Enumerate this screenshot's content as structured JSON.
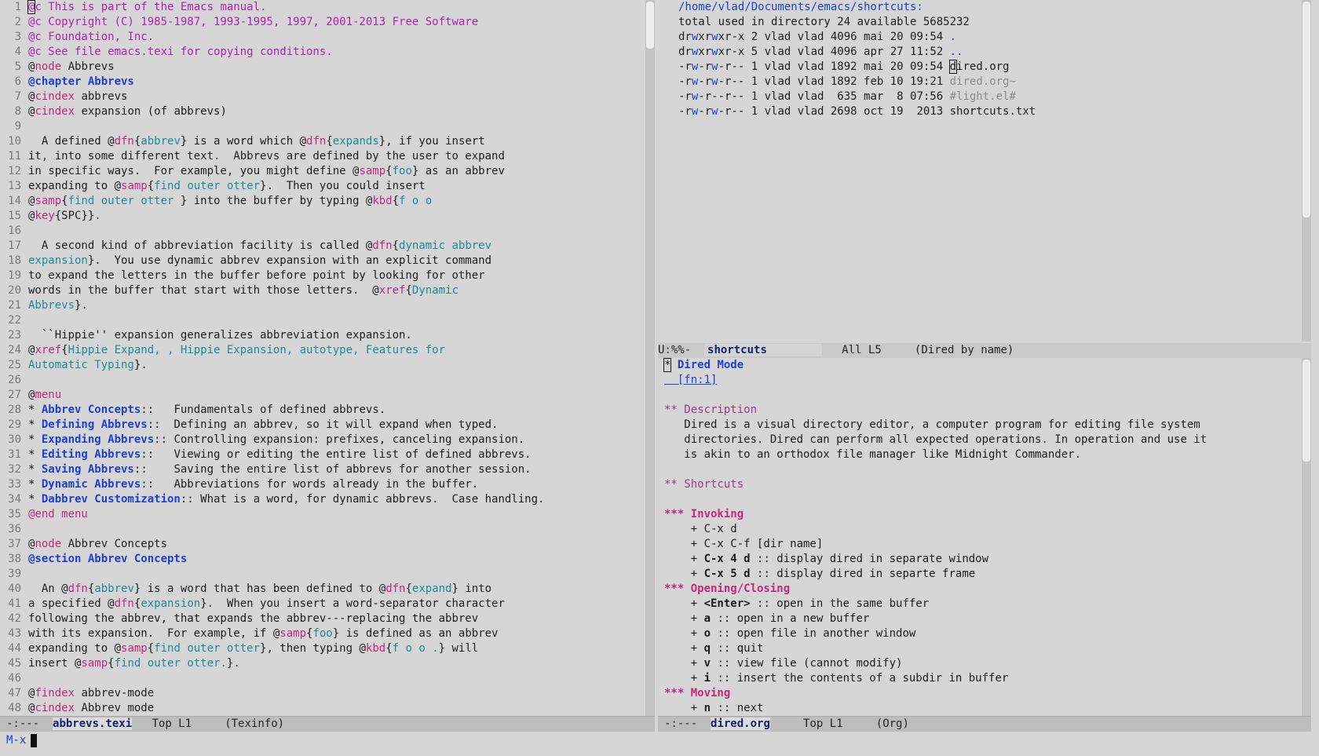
{
  "left": {
    "line_numbers": [
      "1",
      "2",
      "3",
      "4",
      "5",
      "6",
      "7",
      "8",
      "9",
      "10",
      "11",
      "12",
      "13",
      "14",
      "15",
      "16",
      "17",
      "18",
      "19",
      "20",
      "21",
      "22",
      "23",
      "24",
      "25",
      "26",
      "27",
      "28",
      "29",
      "30",
      "31",
      "32",
      "33",
      "34",
      "35",
      "36",
      "37",
      "38",
      "39",
      "40",
      "41",
      "42",
      "43",
      "44",
      "45",
      "46",
      "47",
      "48"
    ],
    "lines": [
      "@c This is part of the Emacs manual.",
      "@c Copyright (C) 1985-1987, 1993-1995, 1997, 2001-2013 Free Software",
      "@c Foundation, Inc.",
      "@c See file emacs.texi for copying conditions.",
      "@node Abbrevs",
      "@chapter Abbrevs",
      "@cindex abbrevs",
      "@cindex expansion (of abbrevs)",
      "",
      "  A defined @dfn{abbrev} is a word which @dfn{expands}, if you insert",
      "it, into some different text.  Abbrevs are defined by the user to expand",
      "in specific ways.  For example, you might define @samp{foo} as an abbrev",
      "expanding to @samp{find outer otter}.  Then you could insert",
      "@samp{find outer otter } into the buffer by typing @kbd{f o o",
      "@key{SPC}}.",
      "",
      "  A second kind of abbreviation facility is called @dfn{dynamic abbrev",
      "expansion}.  You use dynamic abbrev expansion with an explicit command",
      "to expand the letters in the buffer before point by looking for other",
      "words in the buffer that start with those letters.  @xref{Dynamic",
      "Abbrevs}.",
      "",
      "  ``Hippie'' expansion generalizes abbreviation expansion.",
      "@xref{Hippie Expand, , Hippie Expansion, autotype, Features for",
      "Automatic Typing}.",
      "",
      "@menu",
      "* Abbrev Concepts::   Fundamentals of defined abbrevs.",
      "* Defining Abbrevs::  Defining an abbrev, so it will expand when typed.",
      "* Expanding Abbrevs:: Controlling expansion: prefixes, canceling expansion.",
      "* Editing Abbrevs::   Viewing or editing the entire list of defined abbrevs.",
      "* Saving Abbrevs::    Saving the entire list of abbrevs for another session.",
      "* Dynamic Abbrevs::   Abbreviations for words already in the buffer.",
      "* Dabbrev Customization:: What is a word, for dynamic abbrevs.  Case handling.",
      "@end menu",
      "",
      "@node Abbrev Concepts",
      "@section Abbrev Concepts",
      "",
      "  An @dfn{abbrev} is a word that has been defined to @dfn{expand} into",
      "a specified @dfn{expansion}.  When you insert a word-separator character",
      "following the abbrev, that expands the abbrev---replacing the abbrev",
      "with its expansion.  For example, if @samp{foo} is defined as an abbrev",
      "expanding to @samp{find outer otter}, then typing @kbd{f o o .} will",
      "insert @samp{find outer otter.}.",
      "",
      "@findex abbrev-mode",
      "@cindex Abbrev mode"
    ],
    "modeline": {
      "status": "-:---",
      "buffer": "abbrevs.texi",
      "position": "Top L1",
      "mode": "(Texinfo)"
    }
  },
  "dired": {
    "path": "/home/vlad/Documents/emacs/shortcuts:",
    "summary": "total used in directory 24 available 5685232",
    "entries": [
      {
        "perms": "drwxrwxr-x",
        "info": " 2 vlad vlad 4096 mai 20 09:54 ",
        "name": "."
      },
      {
        "perms": "drwxrwxr-x",
        "info": " 5 vlad vlad 4096 apr 27 11:52 ",
        "name": ".."
      },
      {
        "perms": "-rw-rw-r--",
        "info": " 1 vlad vlad 1892 mai 20 09:54 ",
        "name": "dired.org"
      },
      {
        "perms": "-rw-rw-r--",
        "info": " 1 vlad vlad 1892 feb 10 19:21 ",
        "name": "dired.org~"
      },
      {
        "perms": "-rw-r--r--",
        "info": " 1 vlad vlad  635 mar  8 07:56 ",
        "name": "#light.el#"
      },
      {
        "perms": "-rw-rw-r--",
        "info": " 1 vlad vlad 2698 oct 19  2013 ",
        "name": "shortcuts.txt"
      }
    ],
    "modeline": {
      "status": "U:%%-",
      "buffer": "shortcuts",
      "position": "All L5",
      "mode": "(Dired by name)"
    }
  },
  "org": {
    "lines": [
      {
        "cls": "h1",
        "text": "* Dired Mode"
      },
      {
        "cls": "fn",
        "text": "  [fn:1]"
      },
      {
        "cls": "",
        "text": ""
      },
      {
        "cls": "h2",
        "text": "** Description"
      },
      {
        "cls": "",
        "text": "   Dired is a visual directory editor, a computer program for editing file system"
      },
      {
        "cls": "",
        "text": "   directories. Dired can perform all expected operations. In operation and use it"
      },
      {
        "cls": "",
        "text": "   is akin to an orthodox file manager like Midnight Commander."
      },
      {
        "cls": "",
        "text": ""
      },
      {
        "cls": "h2",
        "text": "** Shortcuts"
      },
      {
        "cls": "",
        "text": ""
      },
      {
        "cls": "h3",
        "text": "*** Invoking"
      },
      {
        "cls": "",
        "text": "    + C-x d"
      },
      {
        "cls": "",
        "text": "    + C-x C-f [dir name]"
      },
      {
        "cls": "",
        "key": "C-x 4 d",
        "text": " :: display dired in separate window"
      },
      {
        "cls": "",
        "key": "C-x 5 d",
        "text": " :: display dired in separte frame"
      },
      {
        "cls": "h3",
        "text": "*** Opening/Closing"
      },
      {
        "cls": "",
        "key": "<Enter>",
        "text": " :: open in the same buffer"
      },
      {
        "cls": "",
        "key": "a",
        "text": " :: open in a new buffer"
      },
      {
        "cls": "",
        "key": "o",
        "text": " :: open file in another window"
      },
      {
        "cls": "",
        "key": "q",
        "text": " :: quit"
      },
      {
        "cls": "",
        "key": "v",
        "text": " :: view file (cannot modify)"
      },
      {
        "cls": "",
        "key": "i",
        "text": " :: insert the contents of a subdir in buffer"
      },
      {
        "cls": "h3",
        "text": "*** Moving"
      },
      {
        "cls": "",
        "key": "n",
        "text": " :: next"
      }
    ],
    "modeline": {
      "status": "-:---",
      "buffer": "dired.org",
      "position": "Top L1",
      "mode": "(Org)"
    }
  },
  "minibuffer": {
    "prompt": "M-x"
  },
  "colors": {
    "background": "#d6d6d6",
    "comment": "#b21fb8",
    "keyword": "#c4287a",
    "link": "#1e3fd0",
    "argument": "#1c8b9a"
  }
}
